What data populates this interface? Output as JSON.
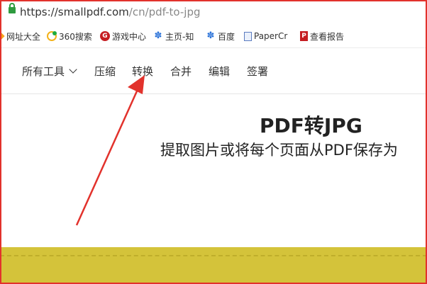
{
  "browser": {
    "url_host": "https://smallpdf.com",
    "url_path": "/cn/pdf-to-jpg"
  },
  "bookmarks": [
    {
      "label": "网址大全",
      "icon": "star-icon"
    },
    {
      "label": "360搜索",
      "icon": "search-360-icon"
    },
    {
      "label": "游戏中心",
      "icon": "game-center-icon"
    },
    {
      "label": "主页-知",
      "icon": "paw-icon"
    },
    {
      "label": "百度",
      "icon": "baidu-paw-icon"
    },
    {
      "label": "PaperCr",
      "icon": "document-icon"
    },
    {
      "label": "查看报告",
      "icon": "report-icon"
    }
  ],
  "nav": {
    "all_tools": "所有工具",
    "compress": "压缩",
    "convert": "转换",
    "merge": "合并",
    "edit": "编辑",
    "sign": "签署"
  },
  "main": {
    "title": "PDF转JPG",
    "subtitle": "提取图片或将每个页面从PDF保存为"
  },
  "colors": {
    "annotation_red": "#e2322c",
    "dropzone_yellow": "#d4c33a"
  }
}
